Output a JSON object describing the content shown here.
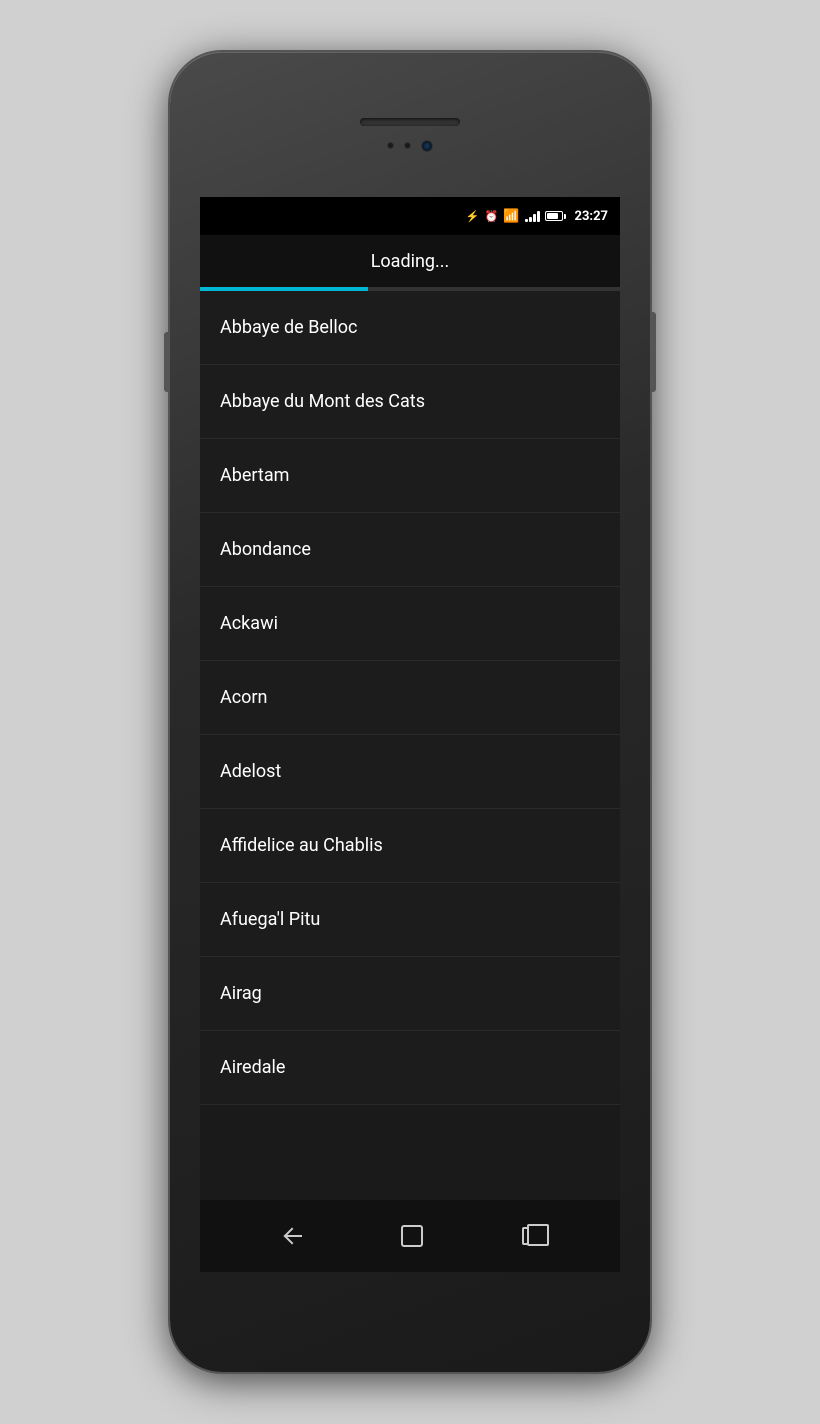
{
  "phone": {
    "status_bar": {
      "time": "23:27",
      "icons": [
        "bluetooth",
        "alarm",
        "wifi",
        "signal",
        "battery"
      ]
    },
    "action_bar": {
      "loading_text": "Loading..."
    },
    "list": {
      "items": [
        {
          "id": 1,
          "label": "Abbaye de Belloc"
        },
        {
          "id": 2,
          "label": "Abbaye du Mont des Cats"
        },
        {
          "id": 3,
          "label": "Abertam"
        },
        {
          "id": 4,
          "label": "Abondance"
        },
        {
          "id": 5,
          "label": "Ackawi"
        },
        {
          "id": 6,
          "label": "Acorn"
        },
        {
          "id": 7,
          "label": "Adelost"
        },
        {
          "id": 8,
          "label": "Affidelice au Chablis"
        },
        {
          "id": 9,
          "label": "Afuega'l Pitu"
        },
        {
          "id": 10,
          "label": "Airag"
        },
        {
          "id": 11,
          "label": "Airedale"
        }
      ]
    },
    "nav": {
      "back_label": "Back",
      "home_label": "Home",
      "recents_label": "Recents"
    }
  }
}
